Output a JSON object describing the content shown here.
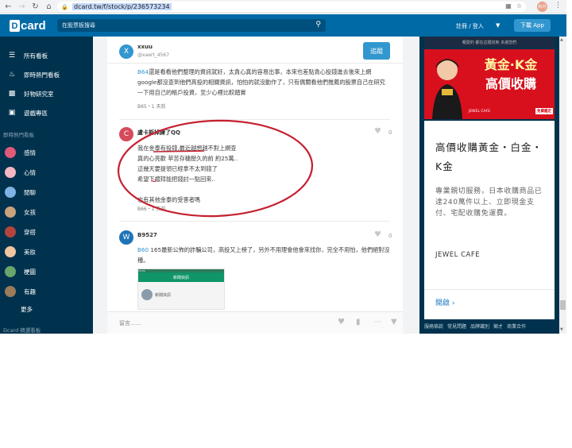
{
  "browser": {
    "url": "dcard.tw/f/stock/p/236573234",
    "profile": "秋月"
  },
  "header": {
    "logo_text": "card",
    "logo_mark": "D",
    "search_placeholder": "在股票板搜尋",
    "login": "註冊 / 登入",
    "download": "下載 App"
  },
  "sidebar": {
    "items": [
      {
        "icon": "board-list-icon",
        "label": "所有看板"
      },
      {
        "icon": "flame-icon",
        "label": "即時熱門看板"
      },
      {
        "icon": "gift-icon",
        "label": "好物研究室"
      },
      {
        "icon": "gamepad-icon",
        "label": "遊戲專區"
      }
    ],
    "section": "即時熱門看板",
    "boards": [
      {
        "label": "感情",
        "color": "#e05a7a"
      },
      {
        "label": "心情",
        "color": "#f4b6c2"
      },
      {
        "label": "閒聊",
        "color": "#7fb2e5"
      },
      {
        "label": "女孩",
        "color": "#c9a27e"
      },
      {
        "label": "穿搭",
        "color": "#b5443e"
      },
      {
        "label": "美妝",
        "color": "#f0c5a0"
      },
      {
        "label": "梗圖",
        "color": "#6aa56b"
      },
      {
        "label": "有趣",
        "color": "#9b7b5a"
      }
    ],
    "more": "更多",
    "bottom": "Dcard 精選看板"
  },
  "post": {
    "author_initial": "X",
    "author": "xxuu",
    "author_id": "@xaert_4567",
    "follow": "追蹤"
  },
  "comments": [
    {
      "floor": "B64",
      "text": "還是看看他們整理的資訊就好，太貪心真的容易出事，本來也差點貪心投錢進去後來上網google都沒查到他們高投的相關資訊，怕怕的就沒動作了，只有偶爾看他們推薦的股票自己在研究一下用自己的帳戶投資，至少心裡比較踏實",
      "meta": "B65・1 天前"
    },
    {
      "initial": "C",
      "name": "盧卡斯掉練了QQ",
      "likes": "0",
      "lines": [
        "我在金泰有投錢,最近越想越不對上網查",
        "真的心亮歡 苹苦存穗壓久的前 約25萬..",
        "這幾天要提領已經拿不太到錢了",
        "希望下禮拜能把錢討一點回來..",
        "",
        "也有其他金泰的受害者嗎"
      ],
      "meta": "B66・1 天前"
    },
    {
      "initial": "W",
      "name": "B9527",
      "likes": "0",
      "floor": "B60",
      "text": " 165最新公佈的詐騙公司，高投又上榜了，另外不用理會他會來找你，完全不用怕，他們絕對沒種。",
      "thumb_top": "10:24",
      "thumb_tab": "新聞快訊",
      "thumb_row": "新聞快訊"
    }
  ],
  "reply": {
    "placeholder": "留言……"
  },
  "ad": {
    "top_strip": "親愛的 都在這裡找到 多謝您們",
    "headline1": "黃金·K金",
    "headline2": "高價收購",
    "brand_small": "JEWEL CAFE",
    "free_badge": "免費鑑定",
    "title": "高價收購黃金・白金・K金",
    "desc": "專業親切服務，日本收購商品已達240萬件以上、立即現金支付、宅配收購免運費。",
    "brand": "JEWEL CAFE",
    "open": "開啟",
    "bg_color": "#d8101d"
  },
  "footer": {
    "links": [
      "服務條款",
      "常見問題",
      "品牌識別",
      "徵才",
      "商業合作"
    ]
  },
  "colors": {
    "header": "#006aa6",
    "sidebar": "#00324e",
    "accent": "#3397cf",
    "annotation": "#c5202f"
  }
}
